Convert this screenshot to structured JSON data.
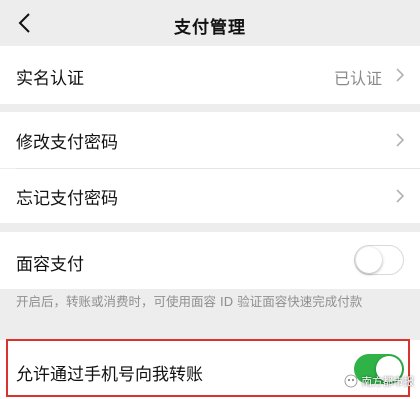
{
  "nav": {
    "back_icon": "chevron-left-icon",
    "title": "支付管理"
  },
  "rows": {
    "real_name": {
      "label": "实名认证",
      "value": "已认证"
    },
    "change_password": {
      "label": "修改支付密码"
    },
    "forgot_password": {
      "label": "忘记支付密码"
    },
    "face_pay": {
      "label": "面容支付",
      "enabled": false
    },
    "phone_transfer": {
      "label": "允许通过手机号向我转账",
      "enabled": true
    }
  },
  "hint": "开启后，转账或消费时，可使用面容 ID 验证面容快速完成付款",
  "watermark": {
    "text": "南方都市报",
    "icon": "wechat-official-account-icon"
  },
  "colors": {
    "background": "#ededed",
    "toggle_on": "#2fb347",
    "highlight_border": "#d9342b"
  }
}
